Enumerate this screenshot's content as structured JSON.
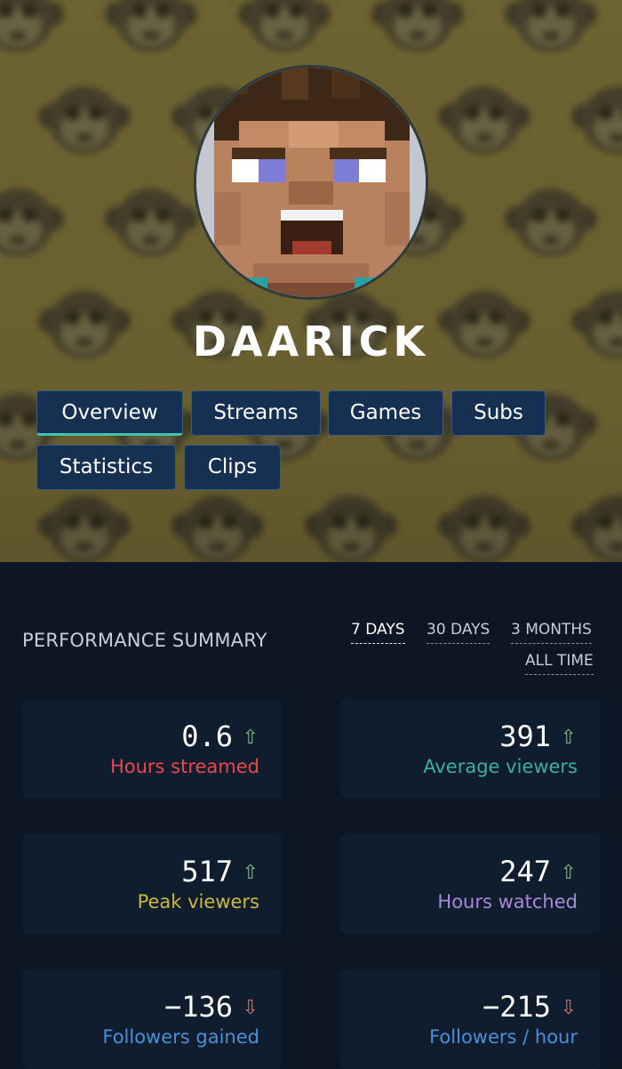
{
  "profile": {
    "username": "DAARICK"
  },
  "tabs": [
    {
      "label": "Overview",
      "active": true
    },
    {
      "label": "Streams",
      "active": false
    },
    {
      "label": "Games",
      "active": false
    },
    {
      "label": "Subs",
      "active": false
    },
    {
      "label": "Statistics",
      "active": false
    },
    {
      "label": "Clips",
      "active": false
    }
  ],
  "performance": {
    "title": "PERFORMANCE SUMMARY",
    "ranges": [
      {
        "label": "7 DAYS",
        "active": true
      },
      {
        "label": "30 DAYS",
        "active": false
      },
      {
        "label": "3 MONTHS",
        "active": false
      },
      {
        "label": "ALL TIME",
        "active": false
      }
    ],
    "cards": [
      {
        "value": "0.6",
        "trend": "up",
        "arrow": "⇧",
        "label": "Hours streamed",
        "label_color": "#e8484f"
      },
      {
        "value": "391",
        "trend": "up",
        "arrow": "⇧",
        "label": "Average viewers",
        "label_color": "#3cb09a"
      },
      {
        "value": "517",
        "trend": "up",
        "arrow": "⇧",
        "label": "Peak viewers",
        "label_color": "#c8bb3c"
      },
      {
        "value": "247",
        "trend": "up",
        "arrow": "⇧",
        "label": "Hours watched",
        "label_color": "#a88ad8"
      },
      {
        "value": "−136",
        "trend": "down",
        "arrow": "⇩",
        "label": "Followers gained",
        "label_color": "#4a8fd8"
      },
      {
        "value": "−215",
        "trend": "down",
        "arrow": "⇩",
        "label": "Followers / hour",
        "label_color": "#4a8fd8"
      }
    ]
  },
  "colors": {
    "page_bg": "#0c1624",
    "card_bg": "#101d2f",
    "tab_bg": "#163052",
    "tab_active_underline": "#3fc4b0",
    "trend_up": "#7fb77e",
    "trend_down": "#e06a6a"
  },
  "icons": {
    "trend_up": "arrow-up-icon",
    "trend_down": "arrow-down-icon",
    "background_pattern": "monkey-face-pattern"
  }
}
